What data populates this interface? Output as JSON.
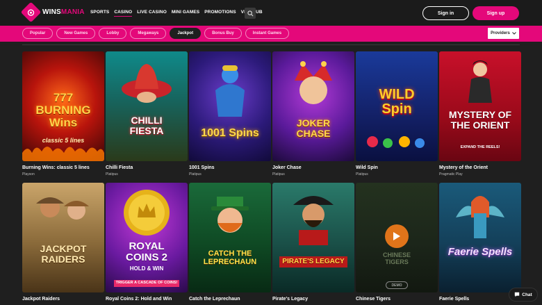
{
  "brand": {
    "logo_prefix": "WINS",
    "logo_suffix": "MANIA",
    "accent": "#e4087a"
  },
  "nav": [
    {
      "label": "SPORTS"
    },
    {
      "label": "CASINO",
      "active": true
    },
    {
      "label": "LIVE CASINO"
    },
    {
      "label": "MINI GAMES"
    },
    {
      "label": "PROMOTIONS"
    },
    {
      "label": "VIP CLUB"
    }
  ],
  "auth": {
    "signin_label": "Sign in",
    "signup_label": "Sign up"
  },
  "filters": [
    {
      "label": "Popular"
    },
    {
      "label": "New Games"
    },
    {
      "label": "Lobby"
    },
    {
      "label": "Megaways"
    },
    {
      "label": "Jackpot",
      "active": true
    },
    {
      "label": "Bonus Buy"
    },
    {
      "label": "Instant Games"
    }
  ],
  "providers_label": "Providers",
  "games": [
    {
      "title": "Burning Wins: classic 5 lines",
      "provider": "Playson",
      "art_title": "777 BURNING Wins",
      "art_sub": "classic 5 lines"
    },
    {
      "title": "Chilli Fiesta",
      "provider": "Platipus",
      "art_title": "CHILLI FIESTA",
      "art_sub": ""
    },
    {
      "title": "1001 Spins",
      "provider": "Platipus",
      "art_title": "1001 Spins",
      "art_sub": ""
    },
    {
      "title": "Joker Chase",
      "provider": "Platipus",
      "art_title": "JOKER CHASE",
      "art_sub": ""
    },
    {
      "title": "Wild Spin",
      "provider": "Platipus",
      "art_title": "WILD Spin",
      "art_sub": ""
    },
    {
      "title": "Mystery of the Orient",
      "provider": "Pragmatic Play",
      "art_title": "MYSTERY OF THE ORIENT",
      "art_sub": "EXPAND THE REELS!"
    },
    {
      "title": "Jackpot Raiders",
      "provider": "",
      "art_title": "JACKPOT RAIDERS",
      "art_sub": ""
    },
    {
      "title": "Royal Coins 2: Hold and Win",
      "provider": "",
      "art_title": "ROYAL COINS 2",
      "art_sub": "HOLD & WIN"
    },
    {
      "title": "Catch the Leprechaun",
      "provider": "",
      "art_title": "CATCH THE LEPRECHAUN",
      "art_sub": ""
    },
    {
      "title": "Pirate's Legacy",
      "provider": "",
      "art_title": "PIRATE'S LEGACY",
      "art_sub": ""
    },
    {
      "title": "Chinese Tigers",
      "provider": "",
      "art_title": "CHINESE TIGERS",
      "art_sub": "",
      "badge": "DEMO"
    },
    {
      "title": "Faerie Spells",
      "provider": "",
      "art_title": "Faerie Spells",
      "art_sub": ""
    }
  ],
  "royal_coins_banner": "TRIGGER A CASCADE OF COINS!",
  "chat_label": "Chat"
}
